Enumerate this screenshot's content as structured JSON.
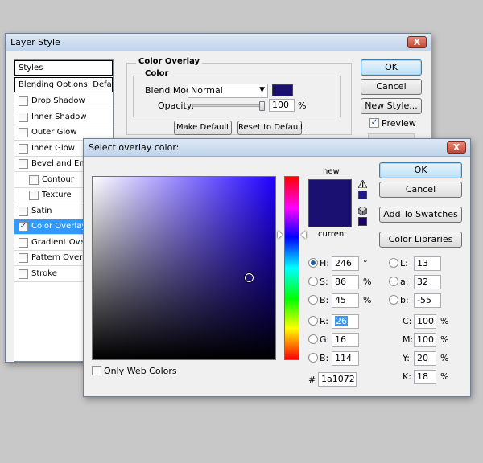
{
  "layer_style": {
    "title": "Layer Style",
    "close_glyph": "X",
    "styles_list": {
      "header": "Styles",
      "blending": "Blending Options: Default",
      "items": [
        {
          "label": "Drop Shadow",
          "checked": false,
          "indent": false
        },
        {
          "label": "Inner Shadow",
          "checked": false,
          "indent": false
        },
        {
          "label": "Outer Glow",
          "checked": false,
          "indent": false
        },
        {
          "label": "Inner Glow",
          "checked": false,
          "indent": false
        },
        {
          "label": "Bevel and Emboss",
          "checked": false,
          "indent": false
        },
        {
          "label": "Contour",
          "checked": false,
          "indent": true
        },
        {
          "label": "Texture",
          "checked": false,
          "indent": true
        },
        {
          "label": "Satin",
          "checked": false,
          "indent": false
        },
        {
          "label": "Color Overlay",
          "checked": true,
          "indent": false
        },
        {
          "label": "Gradient Overlay",
          "checked": false,
          "indent": false
        },
        {
          "label": "Pattern Overlay",
          "checked": false,
          "indent": false
        },
        {
          "label": "Stroke",
          "checked": false,
          "indent": false
        }
      ]
    },
    "overlay": {
      "group_title": "Color Overlay",
      "subgroup_title": "Color",
      "blend_mode_label": "Blend Mode:",
      "blend_mode_value": "Normal",
      "opacity_label": "Opacity:",
      "opacity_value": "100",
      "opacity_fraction": 1.0,
      "opacity_unit": "%",
      "make_default": "Make Default",
      "reset_default": "Reset to Default",
      "swatch_color": "#1a1072"
    },
    "buttons": {
      "ok": "OK",
      "cancel": "Cancel",
      "new_style": "New Style...",
      "preview": "Preview",
      "preview_checked": true
    }
  },
  "picker": {
    "title": "Select overlay color:",
    "close_glyph": "X",
    "new_label": "new",
    "current_label": "current",
    "new_color": "#1a1072",
    "current_color": "#1a1072",
    "field_hue_color": "#2000ff",
    "warning_icon": "warning-triangle-icon",
    "cube_icon": "web-cube-icon",
    "warn_swatch": "#1e1a8c",
    "cube_swatch": "#1a0066",
    "buttons": {
      "ok": "OK",
      "cancel": "Cancel",
      "add_swatches": "Add To Swatches",
      "color_libraries": "Color Libraries"
    },
    "only_web_colors": "Only Web Colors",
    "hsb": [
      {
        "key": "H",
        "label": "H:",
        "value": "246",
        "unit": "°",
        "selected": true
      },
      {
        "key": "S",
        "label": "S:",
        "value": "86",
        "unit": "%",
        "selected": false
      },
      {
        "key": "B",
        "label": "B:",
        "value": "45",
        "unit": "%",
        "selected": false
      }
    ],
    "rgb": [
      {
        "key": "R",
        "label": "R:",
        "value": "26",
        "selected": false,
        "highlight": true
      },
      {
        "key": "G",
        "label": "G:",
        "value": "16",
        "selected": false,
        "highlight": false
      },
      {
        "key": "Bl",
        "label": "B:",
        "value": "114",
        "selected": false,
        "highlight": false
      }
    ],
    "lab": [
      {
        "key": "L",
        "label": "L:",
        "value": "13"
      },
      {
        "key": "a",
        "label": "a:",
        "value": "32"
      },
      {
        "key": "b",
        "label": "b:",
        "value": "-55"
      }
    ],
    "cmyk": [
      {
        "key": "C",
        "label": "C:",
        "value": "100",
        "unit": "%"
      },
      {
        "key": "M",
        "label": "M:",
        "value": "100",
        "unit": "%"
      },
      {
        "key": "Y",
        "label": "Y:",
        "value": "20",
        "unit": "%"
      },
      {
        "key": "K",
        "label": "K:",
        "value": "18",
        "unit": "%"
      }
    ],
    "hex_label": "#",
    "hex_value": "1a1072"
  }
}
